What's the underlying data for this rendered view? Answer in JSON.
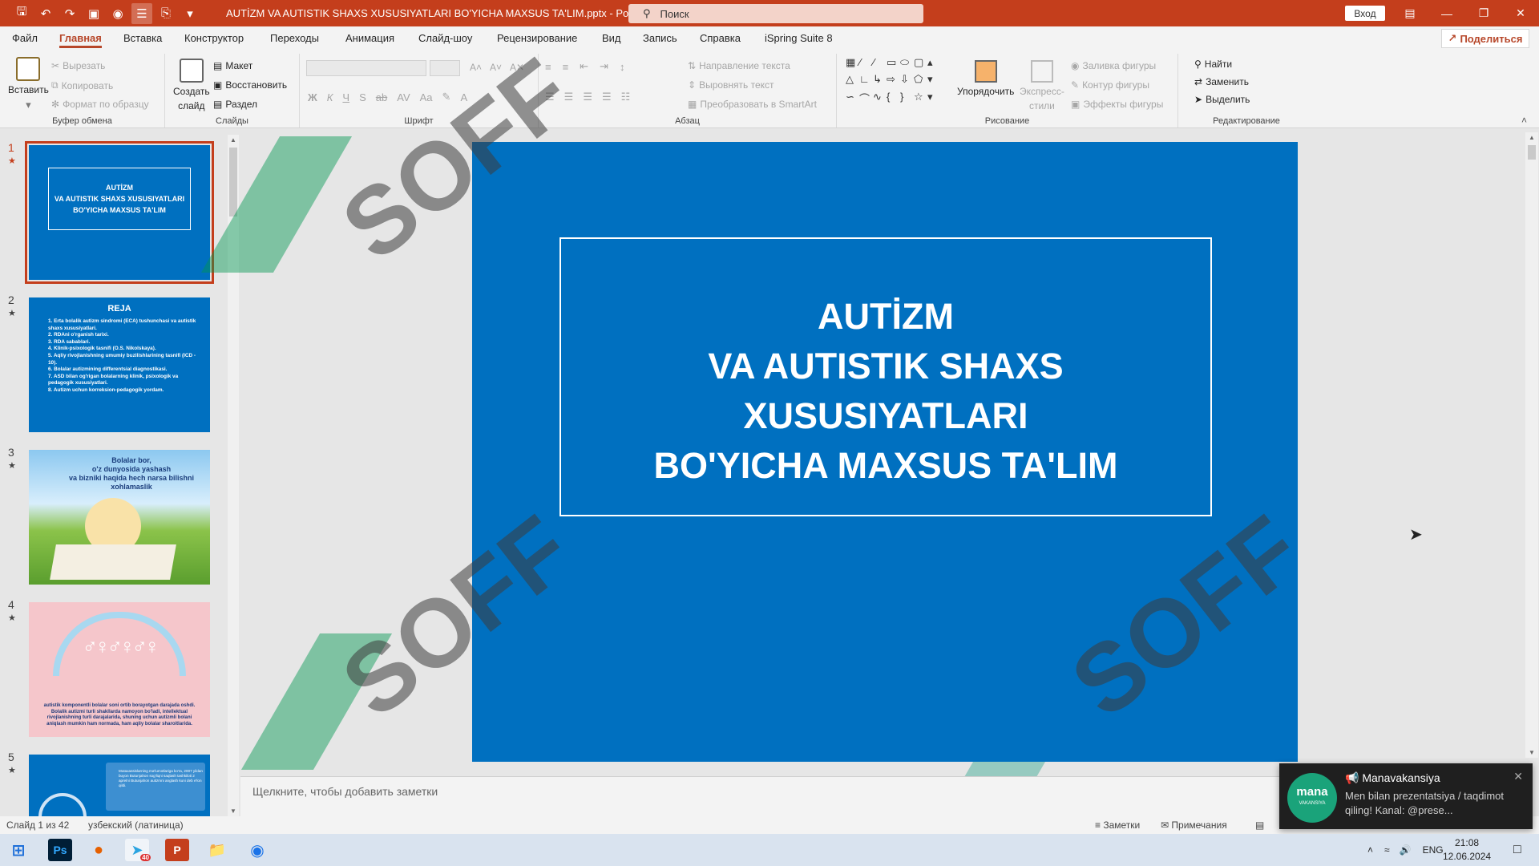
{
  "window": {
    "doc_title": "AUTİZM VA AUTISTIK SHAXS XUSUSIYATLARI BO'YICHA MAXSUS TA'LIM.pptx  -  PowerPoint",
    "search_placeholder": "Поиск",
    "login_label": "Вход"
  },
  "menu": {
    "tabs": [
      "Файл",
      "Главная",
      "Вставка",
      "Конструктор",
      "Переходы",
      "Анимация",
      "Слайд-шоу",
      "Рецензирование",
      "Вид",
      "Запись",
      "Справка",
      "iSpring Suite 8"
    ],
    "active": "Главная",
    "share_label": "Поделиться"
  },
  "ribbon": {
    "clipboard": {
      "paste": "Вставить",
      "cut": "Вырезать",
      "copy": "Копировать",
      "format_painter": "Формат по образцу",
      "label": "Буфер обмена"
    },
    "slides": {
      "new_slide_line1": "Создать",
      "new_slide_line2": "слайд",
      "layout": "Макет",
      "reset": "Восстановить",
      "section": "Раздел",
      "label": "Слайды"
    },
    "font": {
      "label": "Шрифт",
      "bold": "Ж",
      "italic": "К",
      "underline": "Ч",
      "shadow": "S",
      "strike": "ab",
      "spacing": "AV",
      "case": "Aa"
    },
    "paragraph": {
      "text_direction": "Направление текста",
      "align_text": "Выровнять текст",
      "smartart": "Преобразовать в SmartArt",
      "label": "Абзац"
    },
    "drawing": {
      "arrange": "Упорядочить",
      "quick_styles_line1": "Экспресс-",
      "quick_styles_line2": "стили",
      "shape_fill": "Заливка фигуры",
      "shape_outline": "Контур фигуры",
      "shape_effects": "Эффекты фигуры",
      "label": "Рисование"
    },
    "editing": {
      "find": "Найти",
      "replace": "Заменить",
      "select": "Выделить",
      "label": "Редактирование"
    }
  },
  "thumbnails": [
    {
      "num": "1",
      "title": "AUTİZM\nVA AUTISTIK SHAXS XUSUSIYATLARI\nBO'YICHA MAXSUS TA'LIM"
    },
    {
      "num": "2",
      "title": "REJA",
      "items": [
        "1. Erta bolalik autizm sindromi (ECA) tushunchasi va autistik shaxs xususiyatlari.",
        "2. RDAni o'rganish tarixi.",
        "3. RDA sabablari.",
        "4. Klinik-psixologik tasnifi (O.S. Nikolskaya).",
        "5. Aqliy rivojlanishning umumiy buzilishlarining tasnifi (ICD - 10).",
        "6. Bolalar autizmining differentsial diagnostikasi.",
        "7. ASD bilan og'rigan bolalarning klinik, psixologik va pedagogik xususiyatlari.",
        "8. Autizm uchun korreksion-pedagogik yordam."
      ]
    },
    {
      "num": "3",
      "text": "Bolalar bor,\no'z dunyosida yashash\nva bizniki haqida hech narsa bilishni xohlamaslik"
    },
    {
      "num": "4",
      "text": "autistik komponentli bolalar soni ortib borayotgan darajada oshdi. Bolalik autizmi turli shakllarda namoyon bo'ladi, intellektual rivojlanishning turli darajalarida, shuning uchun autizmli bolani aniqlash mumkin ham normada, ham aqliy bolalar sharoitlarida."
    },
    {
      "num": "5",
      "text": "Mutaxassislarning ma'lumotlariga ko'ra, 2007 yildan buyon Butunjahon sog'liqni saqlash tashkiloti 2 aprelni Butunjahon autizmni anglash kuni deb e'lon qildi."
    }
  ],
  "slide": {
    "title_lines": [
      "AUTİZM",
      "VA AUTISTIK SHAXS XUSUSIYATLARI",
      "BO'YICHA MAXSUS TA'LIM"
    ]
  },
  "notes": {
    "placeholder": "Щелкните, чтобы добавить заметки"
  },
  "statusbar": {
    "slide_info": "Слайд 1 из 42",
    "language": "узбекский (латиница)",
    "notes_btn": "Заметки",
    "comments_btn": "Примечания"
  },
  "toast": {
    "app": "Manavakansiya",
    "message": "Men bilan prezentatsiya / taqdimot qiling! Kanal: @prese...",
    "logo_main": "mana",
    "logo_sub": "VAKANSIYA"
  },
  "watermark": {
    "text": "SOFF"
  },
  "taskbar": {
    "lang": "ENG",
    "time": "21:08",
    "date": "12.06.2024",
    "ps_label": "Ps",
    "telegram_badge": "40",
    "ppt_label": "P"
  }
}
